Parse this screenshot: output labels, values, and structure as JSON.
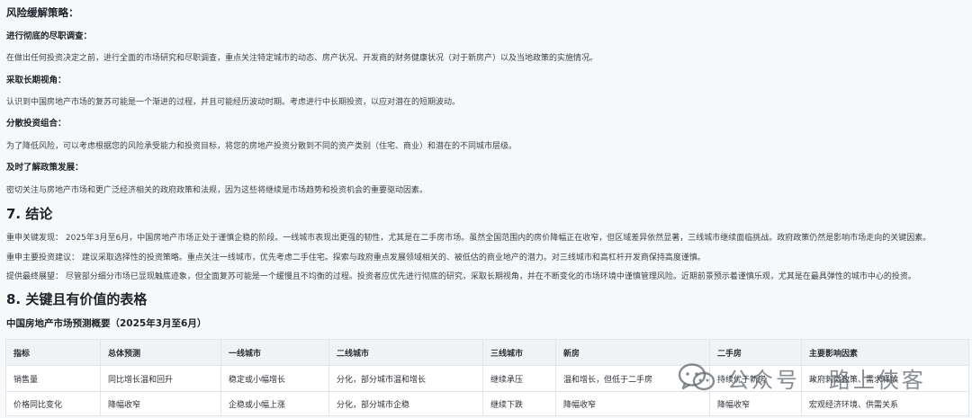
{
  "strategy": {
    "heading": "风险缓解策略：",
    "items": [
      {
        "title": "进行彻底的尽职调查：",
        "text": "在做出任何投资决定之前，进行全面的市场研究和尽职调查，重点关注特定城市的动态、房产状况、开发商的财务健康状况（对于新房产）以及当地政策的实施情况。"
      },
      {
        "title": "采取长期视角：",
        "text": "认识到中国房地产市场的复苏可能是一个渐进的过程，并且可能经历波动时期。考虑进行中长期投资，以应对潜在的短期波动。"
      },
      {
        "title": "分散投资组合：",
        "text": "为了降低风险，可以考虑根据您的风险承受能力和投资目标，将您的房地产投资分散到不同的资产类别（住宅、商业）和潜在的不同城市层级。"
      },
      {
        "title": "及时了解政策发展：",
        "text": "密切关注与房地产市场和更广泛经济相关的政府政策和法规，因为这些将继续是市场趋势和投资机会的重要驱动因素。"
      }
    ]
  },
  "conclusion": {
    "heading": "7. 结论",
    "paragraphs": [
      "重申关键发现： 2025年3月至6月，中国房地产市场正处于谨慎企稳的阶段。一线城市表现出更强的韧性，尤其是在二手房市场。虽然全国范围内的房价降幅正在收窄，但区域差异依然显著，三线城市继续面临挑战。政府政策仍然是影响市场走向的关键因素。",
      "重申主要投资建议： 建议采取选择性的投资策略。重点关注一线城市，优先考虑二手住宅。探索与政府重点发展领域相关的、被低估的商业地产的潜力。对三线城市和高杠杆开发商保持高度谨慎。",
      "提供最终展望： 尽管部分细分市场已显现触底迹象，但全面复苏可能是一个缓慢且不均衡的过程。投资者应优先进行彻底的研究，采取长期视角，并在不断变化的市场环境中谨慎管理风险。近期前景预示着谨慎乐观，尤其是在最具弹性的城市中心的投资。"
    ]
  },
  "table_section": {
    "heading": "8. 关键且有价值的表格",
    "table_title": "中国房地产市场预测概要（2025年3月至6月）",
    "columns": [
      "指标",
      "总体预测",
      "一线城市",
      "二线城市",
      "三线城市",
      "新房",
      "二手房",
      "主要影响因素"
    ],
    "rows": [
      [
        "销售量",
        "同比增长温和回升",
        "稳定或小幅增长",
        "分化，部分城市温和增长",
        "继续承压",
        "温和增长，但低于二手房",
        "持续优于新房",
        "政府刺激政策、需求释放"
      ],
      [
        "价格同比变化",
        "降幅收窄",
        "企稳或小幅上涨",
        "分化，部分城市企稳",
        "继续下跌",
        "降幅收窄",
        "降幅收窄",
        "宏观经济环境、供需关系"
      ]
    ]
  },
  "watermark": {
    "text": "公众号 · 路上侠客",
    "icon": "wechat-icon"
  }
}
